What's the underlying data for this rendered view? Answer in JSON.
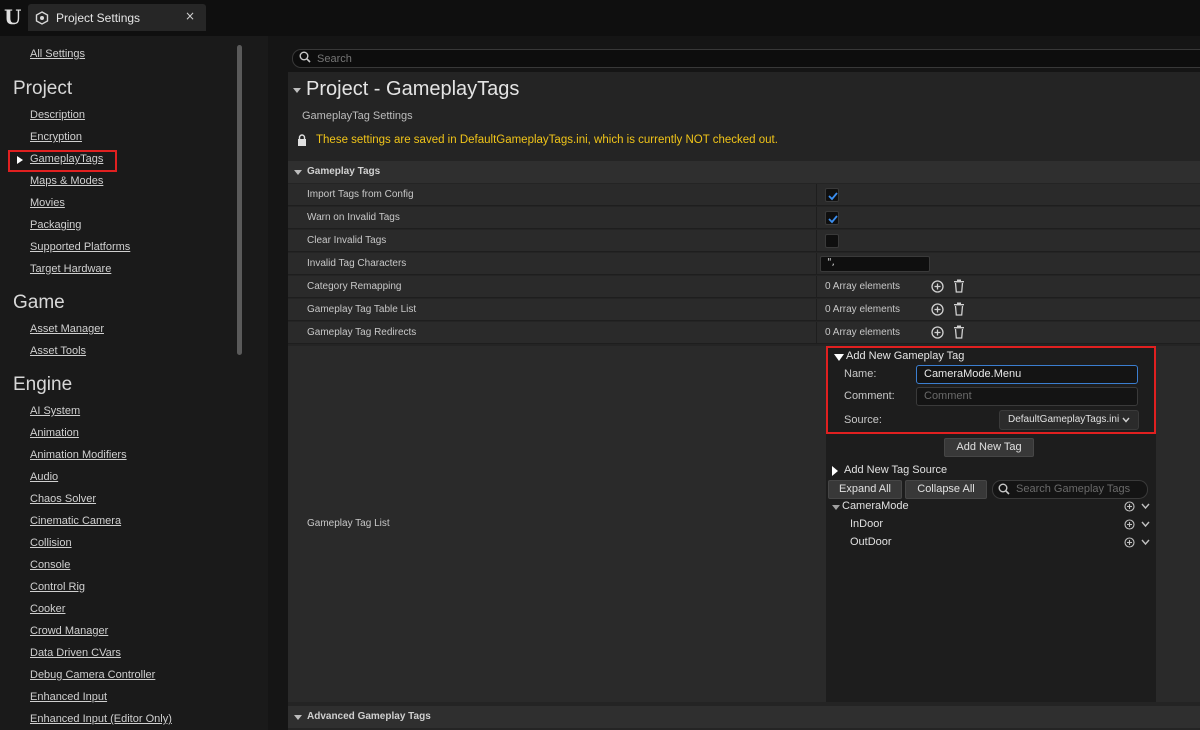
{
  "window": {
    "tab_label": "Project Settings",
    "tab_close": "×",
    "logo_icon": "unreal-logo-icon",
    "tab_icon": "settings-cube-icon"
  },
  "sidebar": {
    "all_settings": "All Settings",
    "categories": [
      {
        "name": "Project",
        "items": [
          "Description",
          "Encryption",
          "GameplayTags",
          "Maps & Modes",
          "Movies",
          "Packaging",
          "Supported Platforms",
          "Target Hardware"
        ]
      },
      {
        "name": "Game",
        "items": [
          "Asset Manager",
          "Asset Tools"
        ]
      },
      {
        "name": "Engine",
        "items": [
          "AI System",
          "Animation",
          "Animation Modifiers",
          "Audio",
          "Chaos Solver",
          "Cinematic Camera",
          "Collision",
          "Console",
          "Control Rig",
          "Cooker",
          "Crowd Manager",
          "Data Driven CVars",
          "Debug Camera Controller",
          "Enhanced Input",
          "Enhanced Input (Editor Only)"
        ]
      }
    ],
    "selected": "GameplayTags",
    "highlight_color": "#e02020"
  },
  "search": {
    "placeholder": "Search"
  },
  "header": {
    "title": "Project - GameplayTags",
    "subtitle": "GameplayTag Settings",
    "warning": "These settings are saved in DefaultGameplayTags.ini, which is currently NOT checked out.",
    "warning_color": "#f0c419"
  },
  "gameplay_tags_section": {
    "title": "Gameplay Tags",
    "props": {
      "import_tags": {
        "label": "Import Tags from Config",
        "checked": true
      },
      "warn_invalid": {
        "label": "Warn on Invalid Tags",
        "checked": true
      },
      "clear_invalid": {
        "label": "Clear Invalid Tags",
        "checked": false
      },
      "invalid_chars": {
        "label": "Invalid Tag Characters",
        "value": "\",",
        "display": "\","
      },
      "category_remap": {
        "label": "Category Remapping",
        "value": "0 Array elements"
      },
      "tag_table_list": {
        "label": "Gameplay Tag Table List",
        "value": "0 Array elements"
      },
      "tag_redirects": {
        "label": "Gameplay Tag Redirects",
        "value": "0 Array elements"
      },
      "tag_list": {
        "label": "Gameplay Tag List"
      }
    }
  },
  "tag_editor": {
    "add_new_header": "Add New Gameplay Tag",
    "name_label": "Name:",
    "name_value": "CameraMode.Menu",
    "comment_label": "Comment:",
    "comment_placeholder": "Comment",
    "source_label": "Source:",
    "source_value": "DefaultGameplayTags.ini",
    "add_new_tag_button": "Add New Tag",
    "add_new_source": "Add New Tag Source",
    "expand_all": "Expand All",
    "collapse_all": "Collapse All",
    "search_placeholder": "Search Gameplay Tags",
    "tree": [
      {
        "label": "CameraMode",
        "level": 0,
        "expanded": true
      },
      {
        "label": "InDoor",
        "level": 1
      },
      {
        "label": "OutDoor",
        "level": 1
      }
    ]
  },
  "advanced_section": {
    "title": "Advanced Gameplay Tags"
  }
}
